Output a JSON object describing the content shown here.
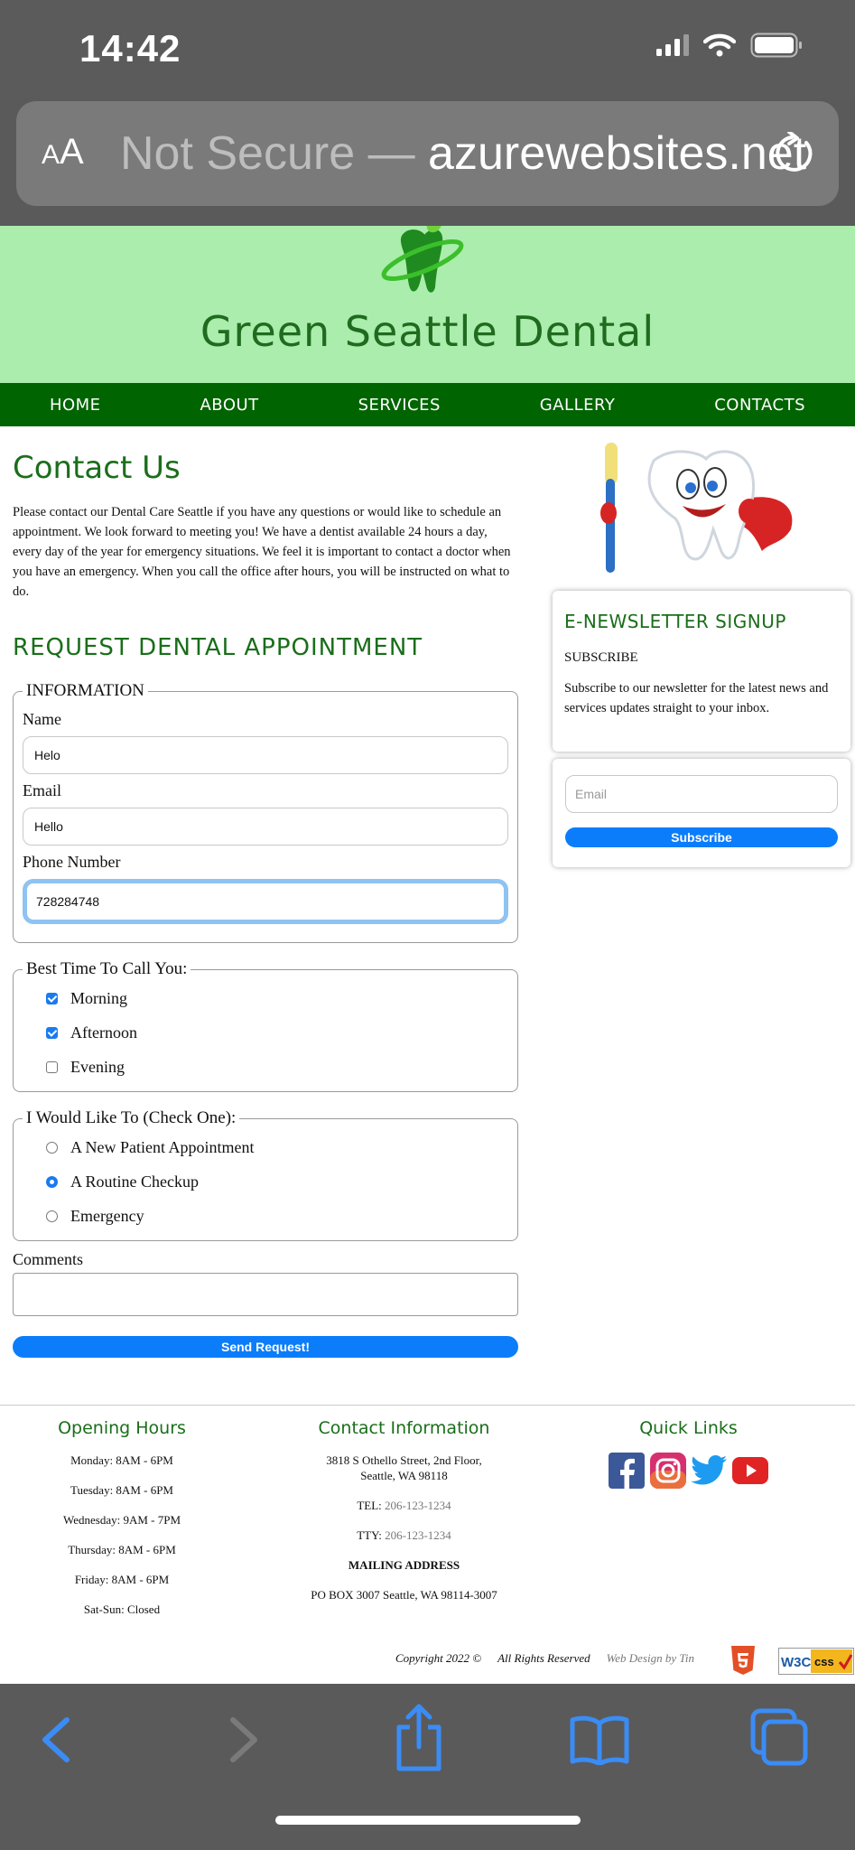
{
  "status_bar": {
    "time": "14:42"
  },
  "url_bar": {
    "aa_label_big": "A",
    "aa_label_small": "A",
    "security": "Not Secure — ",
    "domain": "azurewebsites.net"
  },
  "site": {
    "title": "Green Seattle Dental"
  },
  "nav": [
    "HOME",
    "ABOUT",
    "SERVICES",
    "GALLERY",
    "CONTACTS"
  ],
  "contact": {
    "heading": "Contact Us",
    "intro": "Please contact our Dental Care Seattle if you have any questions or would like to schedule an appointment. We look forward to meeting you! We have a dentist available 24 hours a day, every day of the year for emergency situations. We feel it is important to contact a doctor when you have an emergency. When you call the office after hours, you will be instructed on what to do."
  },
  "form": {
    "heading": "REQUEST DENTAL APPOINTMENT",
    "info_legend": "INFORMATION",
    "name_label": "Name",
    "name_value": "Helo",
    "email_label": "Email",
    "email_value": "Hello",
    "phone_label": "Phone Number",
    "phone_value": "728284748",
    "time_legend": "Best Time To Call You:",
    "time_options": [
      {
        "label": "Morning",
        "checked": true
      },
      {
        "label": "Afternoon",
        "checked": true
      },
      {
        "label": "Evening",
        "checked": false
      }
    ],
    "reason_legend": "I Would Like To (Check One):",
    "reason_options": [
      {
        "label": "A New Patient Appointment",
        "selected": false
      },
      {
        "label": "A Routine Checkup",
        "selected": true
      },
      {
        "label": "Emergency",
        "selected": false
      }
    ],
    "comments_label": "Comments",
    "send_label": "Send Request!"
  },
  "newsletter": {
    "title": "E-NEWSLETTER SIGNUP",
    "subtitle": "SUBSCRIBE",
    "description": "Subscribe to our newsletter for the latest news and services updates straight to your inbox.",
    "email_placeholder": "Email",
    "subscribe_label": "Subscribe"
  },
  "footer": {
    "hours_title": "Opening Hours",
    "hours": [
      "Monday: 8AM - 6PM",
      "Tuesday: 8AM - 6PM",
      "Wednesday: 9AM - 7PM",
      "Thursday: 8AM - 6PM",
      "Friday: 8AM - 6PM",
      "Sat-Sun: Closed"
    ],
    "contact_title": "Contact Information",
    "address_line1": "3818 S Othello Street, 2nd Floor,",
    "address_line2": "Seattle, WA 98118",
    "tel_label": "TEL: ",
    "tel": "206-123-1234",
    "tty_label": "TTY: ",
    "tty": "206-123-1234",
    "mailing_title": "MAILING ADDRESS",
    "mailing": "PO BOX 3007 Seattle, WA 98114-3007",
    "links_title": "Quick Links",
    "copyright": "Copyright 2022 ©",
    "rights": "All Rights Reserved",
    "design": "Web Design by Tin",
    "w3c_text": "W3C",
    "css_text": "css"
  },
  "colors": {
    "header_bg": "#abedac",
    "nav_bg": "#006400",
    "heading_green": "#1a6e1a",
    "button_blue": "#0b7dfa"
  }
}
